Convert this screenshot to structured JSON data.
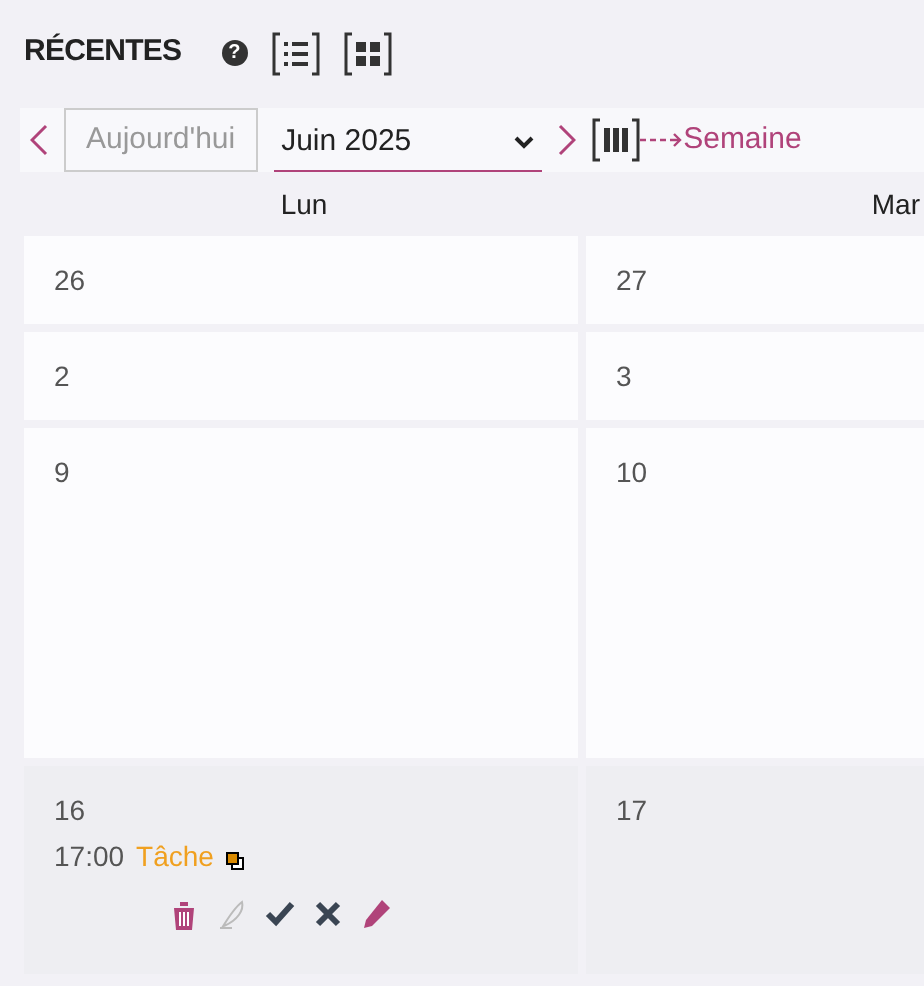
{
  "header": {
    "title": "RÉCENTES",
    "help": "?"
  },
  "nav": {
    "today": "Aujourd'hui",
    "month": "Juin 2025",
    "view_link": "Semaine"
  },
  "day_headers": [
    "Lun",
    "Mar"
  ],
  "weeks": [
    {
      "current": false,
      "tall": false,
      "days": [
        {
          "date": "26"
        },
        {
          "date": "27"
        }
      ]
    },
    {
      "current": false,
      "tall": false,
      "days": [
        {
          "date": "2"
        },
        {
          "date": "3"
        }
      ]
    },
    {
      "current": false,
      "tall": true,
      "days": [
        {
          "date": "9"
        },
        {
          "date": "10"
        }
      ]
    },
    {
      "current": true,
      "tall": false,
      "days": [
        {
          "date": "16",
          "events": [
            {
              "time": "17:00",
              "title": "Tâche"
            }
          ]
        },
        {
          "date": "17"
        }
      ]
    }
  ]
}
